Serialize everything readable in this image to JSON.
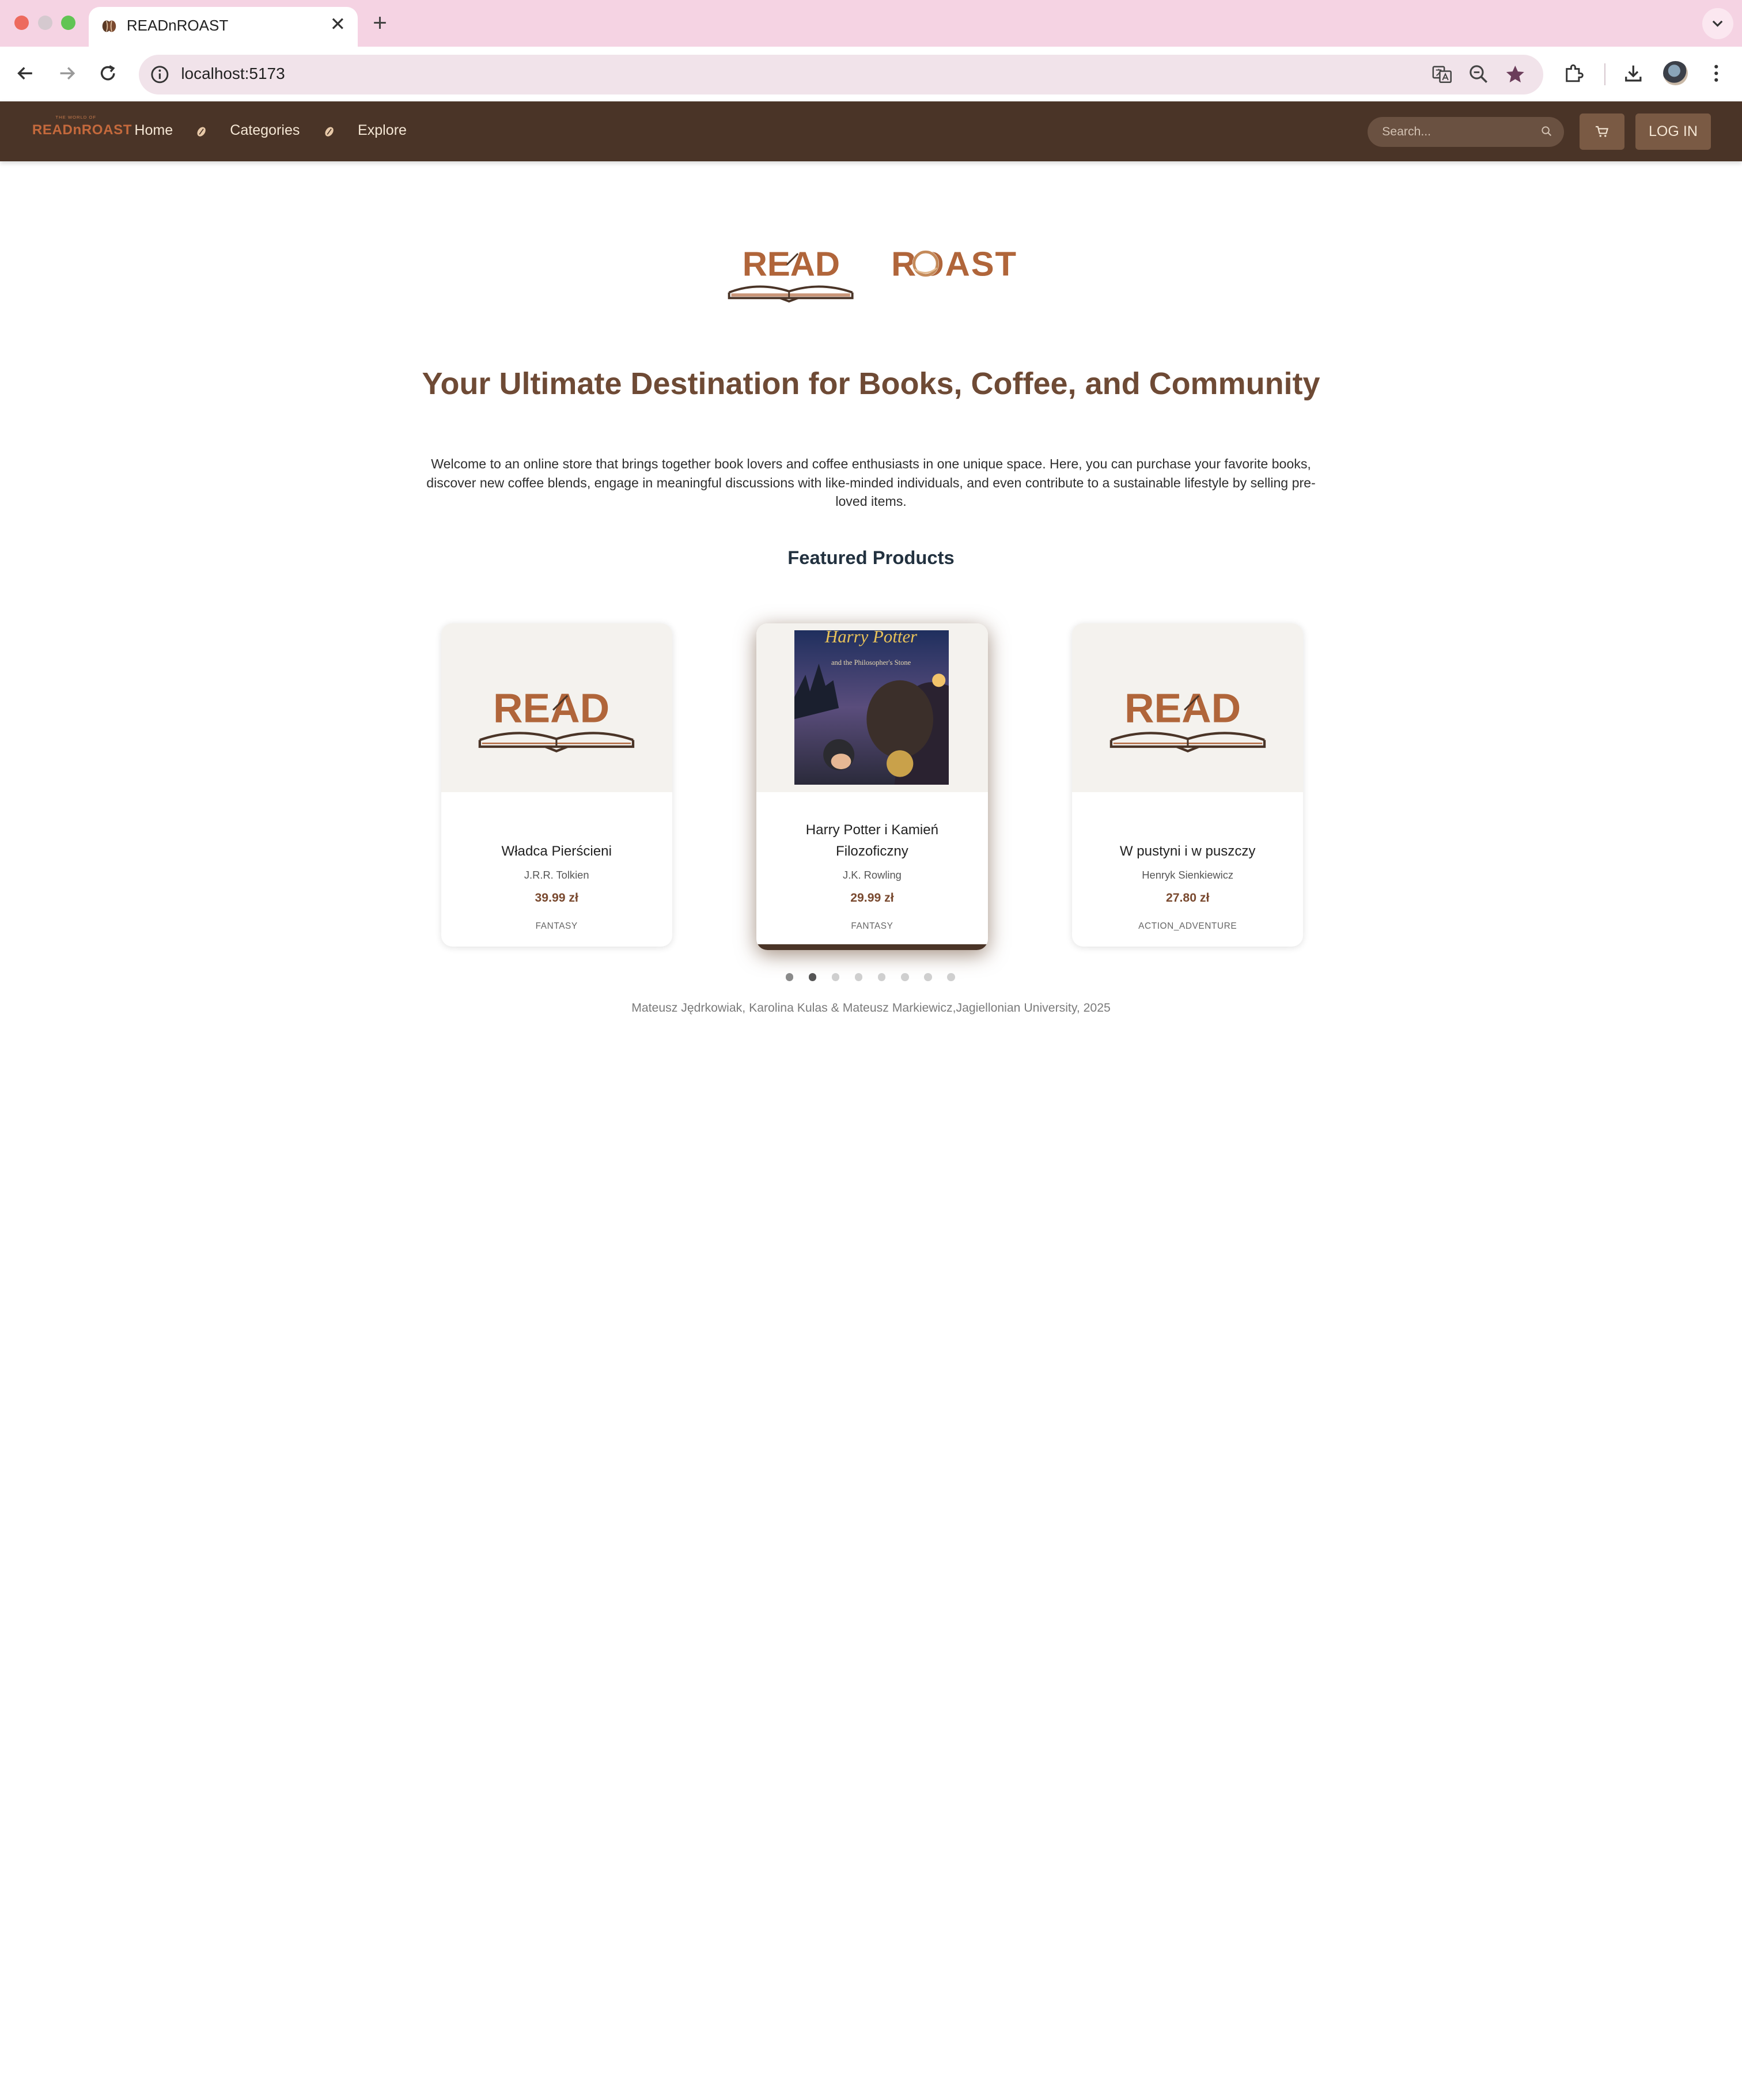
{
  "browser": {
    "tab_title": "READnROAST",
    "url": "localhost:5173"
  },
  "site": {
    "logo_small": "THE WORLD OF",
    "logo_text": "READnROAST",
    "nav": {
      "home": "Home",
      "categories": "Categories",
      "explore": "Explore"
    },
    "search_placeholder": "Search...",
    "login_label": "LOG IN"
  },
  "hero": {
    "logo_left": "READ",
    "logo_right": "ROAST",
    "title": "Your Ultimate Destination for Books, Coffee, and Community",
    "description": "Welcome to an online store that brings together book lovers and coffee enthusiasts in one unique space. Here, you can purchase your favorite books, discover new coffee blends, engage in meaningful discussions with like-minded individuals, and even contribute to a sustainable lifestyle by selling pre-loved items."
  },
  "featured": {
    "title": "Featured Products",
    "products": [
      {
        "title": "Władca Pierścieni",
        "author": "J.R.R. Tolkien",
        "price": "39.99 zł",
        "category": "FANTASY",
        "image": "read-placeholder"
      },
      {
        "title": "Harry Potter i Kamień Filozoficzny",
        "author": "J.K. Rowling",
        "price": "29.99 zł",
        "category": "FANTASY",
        "image": "cover",
        "cover_title": "Harry Potter",
        "cover_subtitle": "and the Philosopher's Stone"
      },
      {
        "title": "W pustyni i w puszczy",
        "author": "Henryk Sienkiewicz",
        "price": "27.80 zł",
        "category": "ACTION_ADVENTURE",
        "image": "read-placeholder"
      }
    ],
    "carousel_dots": 8,
    "active_dot": 1
  },
  "footer": {
    "text": "Mateusz Jędrkowiak, Karolina Kulas & Mateusz Markiewicz,Jagiellonian University, 2025"
  },
  "colors": {
    "nav_bg": "#4a3427",
    "accent": "#b0653a",
    "title": "#6e4a35"
  }
}
